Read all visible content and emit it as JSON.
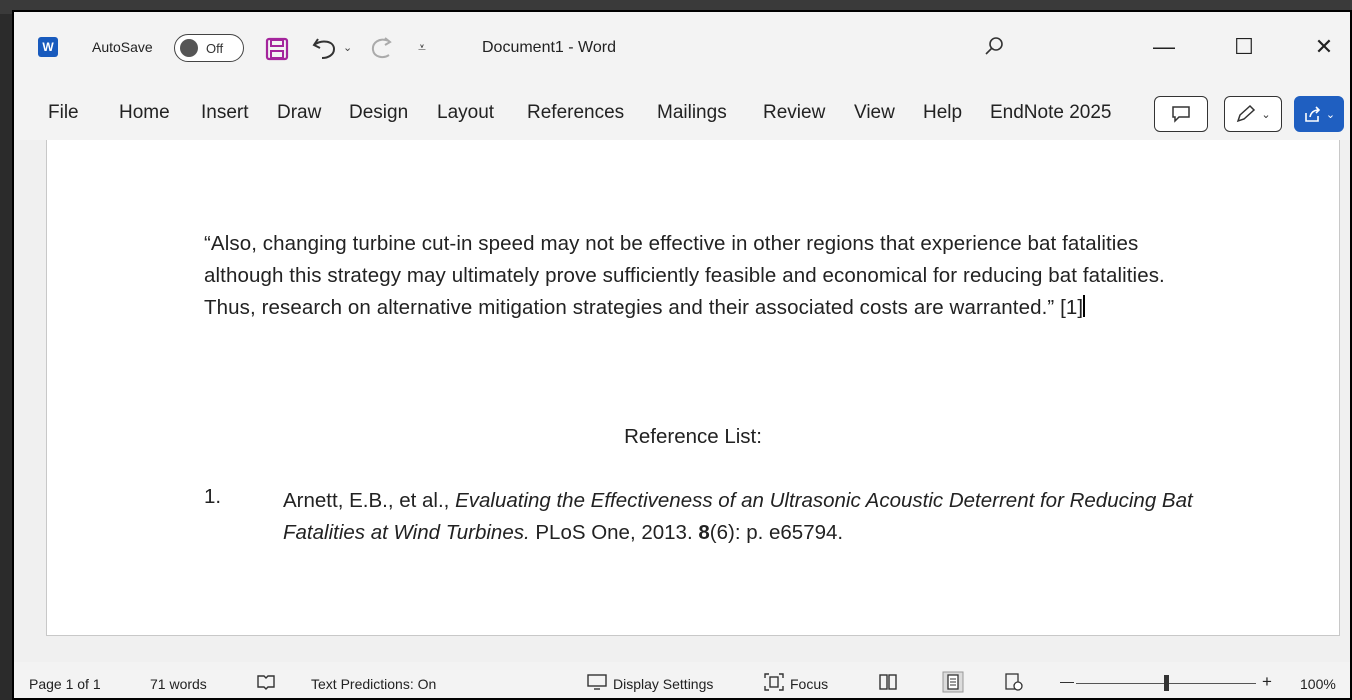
{
  "titlebar": {
    "logo_letter": "W",
    "autosave_label": "AutoSave",
    "autosave_state": "Off",
    "document_title": "Document1 - Word",
    "minimize_glyph": "—",
    "maximize_glyph": "☐",
    "close_glyph": "✕"
  },
  "ribbon": {
    "tabs": [
      "File",
      "Home",
      "Insert",
      "Draw",
      "Design",
      "Layout",
      "References",
      "Mailings",
      "Review",
      "View",
      "Help",
      "EndNote 2025"
    ]
  },
  "document": {
    "quote": "“Also, changing turbine cut-in speed may not be effective in other regions that experience bat fatalities although this strategy may ultimately prove sufficiently feasible and economical for reducing bat fatalities. Thus, research on alternative mitigation strategies and their associated costs are warranted.” [1]",
    "reference_heading": "Reference List:",
    "reference": {
      "number": "1.",
      "authors": "Arnett, E.B., et al., ",
      "title": "Evaluating the Effectiveness of an Ultrasonic Acoustic Deterrent for Reducing Bat Fatalities at Wind Turbines.",
      "journal": " PLoS One, 2013. ",
      "volume": "8",
      "issue_pages": "(6): p. e65794."
    }
  },
  "statusbar": {
    "page": "Page 1 of 1",
    "words": "71 words",
    "text_predictions": "Text Predictions: On",
    "display_settings": "Display Settings",
    "focus": "Focus",
    "zoom_minus": "—",
    "zoom_plus": "+",
    "zoom": "100%"
  },
  "colors": {
    "accent": "#185abd",
    "save_icon": "#a4259c",
    "share_button": "#1f5fc1"
  }
}
